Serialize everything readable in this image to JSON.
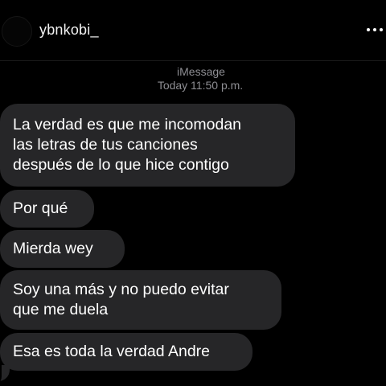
{
  "header": {
    "username": "ybnkobi_",
    "more_icon": "more-horizontal-icon"
  },
  "meta": {
    "service": "iMessage",
    "timestamp": "Today 11:50 p.m."
  },
  "messages": [
    {
      "text": "La verdad es que me incomodan\nlas letras de tus canciones\ndespués de lo que hice contigo"
    },
    {
      "text": "Por qué"
    },
    {
      "text": "Mierda wey"
    },
    {
      "text": "Soy una más y no puedo evitar\nque me duela"
    },
    {
      "text": "Esa es toda la verdad Andre"
    }
  ],
  "colors": {
    "background": "#000000",
    "bubble": "#262628",
    "meta_text": "#8e8e93",
    "message_text": "#ffffff"
  }
}
